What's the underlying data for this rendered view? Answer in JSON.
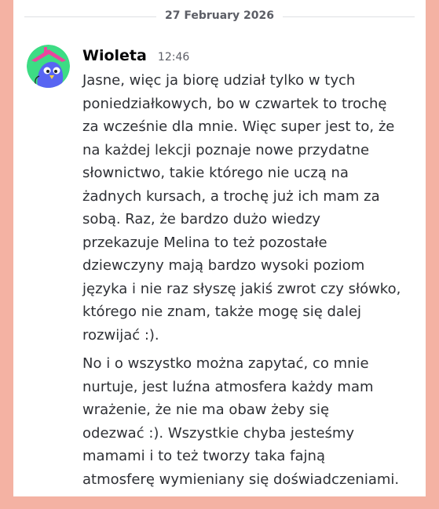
{
  "date_divider": "27 February 2026",
  "message": {
    "author": "Wioleta",
    "time": "12:46",
    "paragraphs": [
      [
        "Jasne, więc ja biorę udział tylko w tych",
        "poniedziałkowych, bo w czwartek to trochę",
        "za wcześnie dla mnie. Więc super jest to, że",
        "na każdej lekcji poznaje nowe przydatne",
        "słownictwo, takie którego nie uczą na",
        "żadnych kursach, a trochę już ich mam za",
        "sobą. Raz, że bardzo dużo wiedzy",
        "przekazuje Melina to też pozostałe",
        "dziewczyny mają bardzo wysoki poziom",
        "języka i nie raz słyszę jakiś zwrot czy słówko,",
        "którego nie znam, także mogę się dalej",
        "rozwijać :)."
      ],
      [
        "No i o wszystko można zapytać, co mnie",
        "nurtuje, jest luźna atmosfera każdy mam",
        "wrażenie, że nie ma obaw żeby się",
        "odezwać :). Wszystkie chyba jesteśmy",
        "mamami i to też tworzy taka fajną",
        "atmosferę wymieniany się doświadczeniami."
      ]
    ]
  },
  "avatar": {
    "icon": "bird-avatar",
    "bg": "#3ddc84",
    "accent": "#eb459e",
    "bird": "#5865f2"
  },
  "colors": {
    "frame": "#f4b2a3",
    "card": "#ffffff",
    "text": "#2e3035",
    "muted": "#5c5e66"
  }
}
